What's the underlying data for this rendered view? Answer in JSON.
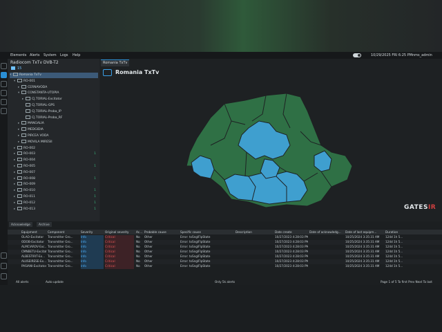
{
  "menu": [
    "Elements",
    "Alerts",
    "System",
    "Logs",
    "Help"
  ],
  "topbar": {
    "datetime": "10/29/2025 FRI 6:25 PM",
    "user": "nms_admin"
  },
  "tree": {
    "title": "Radiocom TxTv DVB-T2",
    "count": "15",
    "rows": [
      {
        "label": "Romania TxTv",
        "indent": 0,
        "arrow": "▾",
        "selected": true,
        "badge": ""
      },
      {
        "label": "RO-001",
        "indent": 1,
        "arrow": "▾",
        "selected": false,
        "badge": ""
      },
      {
        "label": "CERNAVODA",
        "indent": 2,
        "arrow": "▸",
        "selected": false,
        "badge": ""
      },
      {
        "label": "CONSTANTA-UTOPIA",
        "indent": 2,
        "arrow": "▾",
        "selected": false,
        "badge": ""
      },
      {
        "label": "CJ.TORIAL-Excitator",
        "indent": 3,
        "arrow": "▸",
        "selected": false,
        "badge": ""
      },
      {
        "label": "CJ.TORIAL-GPS",
        "indent": 3,
        "arrow": "",
        "selected": false,
        "badge": ""
      },
      {
        "label": "CJ.TORIAL-Proba_IP",
        "indent": 3,
        "arrow": "",
        "selected": false,
        "badge": ""
      },
      {
        "label": "CJ.TORIAL-Proba_RF",
        "indent": 3,
        "arrow": "",
        "selected": false,
        "badge": ""
      },
      {
        "label": "MANGALIA",
        "indent": 2,
        "arrow": "▸",
        "selected": false,
        "badge": ""
      },
      {
        "label": "MEDGIDIA",
        "indent": 2,
        "arrow": "▸",
        "selected": false,
        "badge": ""
      },
      {
        "label": "PIRCEA VODA",
        "indent": 2,
        "arrow": "▸",
        "selected": false,
        "badge": ""
      },
      {
        "label": "MOVILA MIRESII",
        "indent": 2,
        "arrow": "▸",
        "selected": false,
        "badge": ""
      },
      {
        "label": "RO-002",
        "indent": 1,
        "arrow": "▸",
        "selected": false,
        "badge": ""
      },
      {
        "label": "RO-003",
        "indent": 1,
        "arrow": "▸",
        "selected": false,
        "badge": "1"
      },
      {
        "label": "RO-004",
        "indent": 1,
        "arrow": "▸",
        "selected": false,
        "badge": ""
      },
      {
        "label": "RO-005",
        "indent": 1,
        "arrow": "▸",
        "selected": false,
        "badge": "1"
      },
      {
        "label": "RO-007",
        "indent": 1,
        "arrow": "▸",
        "selected": false,
        "badge": ""
      },
      {
        "label": "RO-008",
        "indent": 1,
        "arrow": "▸",
        "selected": false,
        "badge": "1"
      },
      {
        "label": "RO-009",
        "indent": 1,
        "arrow": "▸",
        "selected": false,
        "badge": ""
      },
      {
        "label": "RO-010",
        "indent": 1,
        "arrow": "▸",
        "selected": false,
        "badge": "1"
      },
      {
        "label": "RO-011",
        "indent": 1,
        "arrow": "▸",
        "selected": false,
        "badge": "1"
      },
      {
        "label": "RO-012",
        "indent": 1,
        "arrow": "▸",
        "selected": false,
        "badge": "1"
      },
      {
        "label": "RO-013",
        "indent": 1,
        "arrow": "▸",
        "selected": false,
        "badge": "1"
      }
    ]
  },
  "main": {
    "tab": "Romania TxTv",
    "title": "Romania TxTv",
    "brand_main": "GATES",
    "brand_accent": "IR"
  },
  "map_colors": {
    "green": "#2f7045",
    "blue": "#3f9fcf",
    "border": "#1e2123"
  },
  "alerts": {
    "tabs": [
      "Acknowledge",
      "Archive"
    ],
    "columns": [
      "Equipment",
      "Component",
      "Severity",
      "Original severity",
      "Ac...",
      "Probable cause",
      "Specific cause",
      "Description",
      "Date create",
      "Date of acknowledg...",
      "Date of last equipm...",
      "Duration"
    ],
    "rows": [
      [
        "OLAO-Excitator",
        "Transmitter Gro...",
        "Info",
        "Critical",
        "No",
        "Other",
        "Error: txSnglFlpState",
        "",
        "10/27/2023 4:28:03 PM",
        "",
        "10/25/2024 3:35:31 AM",
        "124d 1h 5..."
      ],
      [
        "ODOB-Excitator",
        "Transmitter Gro...",
        "Info",
        "Critical",
        "No",
        "Other",
        "Error: txSnglFlpState",
        "",
        "10/27/2023 4:28:03 PM",
        "",
        "10/25/2024 3:35:31 AM",
        "124d 1h 5..."
      ],
      [
        "ALMCIAROV-Exc...",
        "Transmitter Gro...",
        "Info",
        "Critical",
        "No",
        "Other",
        "Error: txSnglFlpState",
        "",
        "10/27/2023 4:28:03 PM",
        "",
        "10/25/2024 3:35:31 AM",
        "124d 1h 5..."
      ],
      [
        "CMNBETU-Excitat...",
        "Transmitter Gro...",
        "Info",
        "Critical",
        "No",
        "Other",
        "Error: txSnglFlpState",
        "",
        "10/27/2023 4:28:03 PM",
        "",
        "10/25/2024 3:35:31 AM",
        "124d 1h 5..."
      ],
      [
        "ALBESTIRIT-Ex...",
        "Transmitter Gro...",
        "Info",
        "Critical",
        "No",
        "Other",
        "Error: txSnglFlpState",
        "",
        "10/27/2023 4:28:03 PM",
        "",
        "10/25/2024 3:35:31 AM",
        "124d 1h 5..."
      ],
      [
        "ALUSEIRESE-Ex...",
        "Transmitter Gro...",
        "Info",
        "Critical",
        "No",
        "Other",
        "Error: txSnglFlpState",
        "",
        "10/27/2023 4:28:03 PM",
        "",
        "10/25/2024 3:35:31 AM",
        "124d 1h 5..."
      ],
      [
        "PASIANI-Excitator",
        "Transmitter Gro...",
        "Info",
        "Critical",
        "No",
        "Other",
        "Error: txSnglFlpState",
        "",
        "10/27/2023 4:28:03 PM",
        "",
        "10/25/2024 3:35:31 AM",
        "124d 1h 5..."
      ]
    ],
    "footer": {
      "filter": "All alerts",
      "auto_update": "Auto update",
      "summary": "Only 5k alerts",
      "pager": "Page 1 of 5 To first Prev Next To last"
    }
  }
}
